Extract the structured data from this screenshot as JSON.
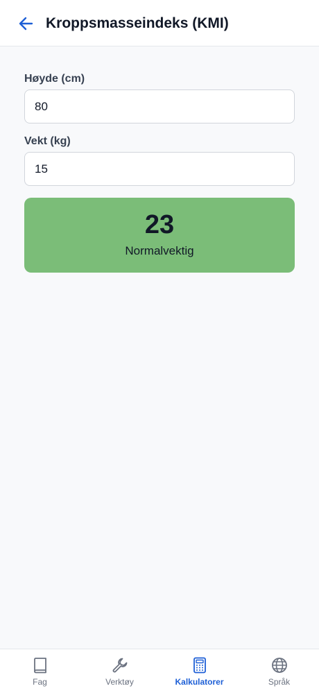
{
  "header": {
    "title": "Kroppsmasseindeks (KMI)",
    "back_icon": "arrow-left-icon"
  },
  "form": {
    "height_label": "Høyde (cm)",
    "height_value": "80",
    "weight_label": "Vekt (kg)",
    "weight_value": "15"
  },
  "result": {
    "value": "23",
    "category": "Normalvektig",
    "color": "#7bbd78"
  },
  "nav": {
    "items": [
      {
        "label": "Fag",
        "icon": "book-icon"
      },
      {
        "label": "Verktøy",
        "icon": "wrench-icon"
      },
      {
        "label": "Kalkulatorer",
        "icon": "calculator-icon",
        "active": true
      },
      {
        "label": "Språk",
        "icon": "globe-icon"
      }
    ]
  },
  "colors": {
    "accent": "#1d5fd6",
    "background": "#f8f9fb"
  }
}
